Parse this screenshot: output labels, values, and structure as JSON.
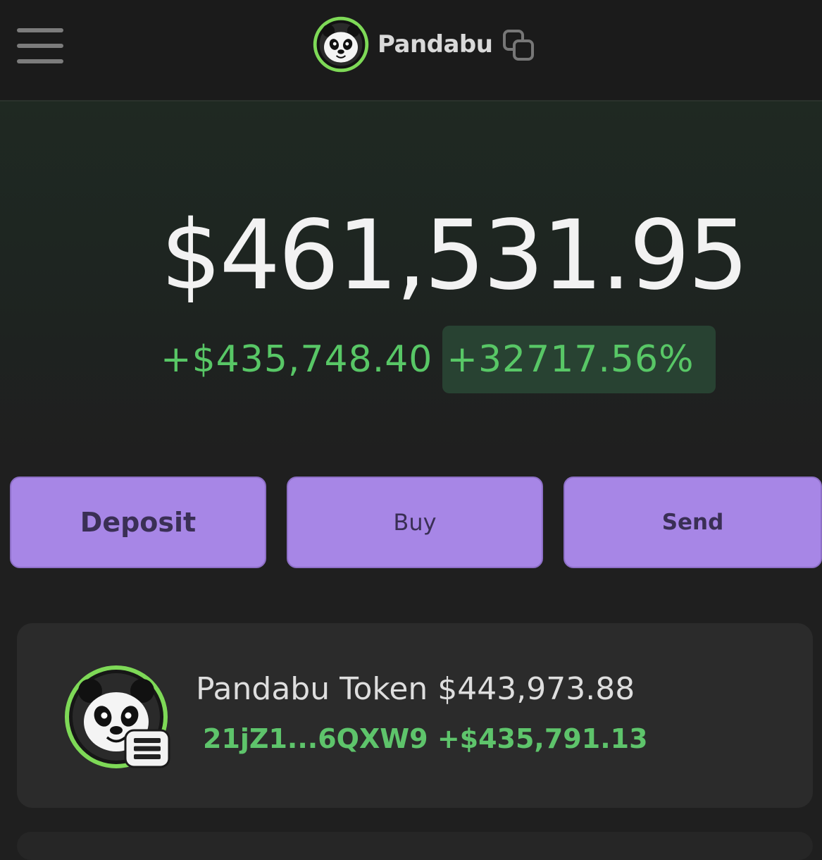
{
  "app": {
    "name": "Pandabu"
  },
  "balance": {
    "total": "$461,531.95",
    "change_amount": "+$435,748.40",
    "change_percent": "+32717.56%"
  },
  "actions": {
    "deposit": "Deposit",
    "buy": "Buy",
    "send": "Send"
  },
  "tokens": [
    {
      "name_value": "Pandabu Token $443,973.88",
      "address_change": "21jZ1...6QXW9 +$435,791.13"
    }
  ],
  "colors": {
    "background": "#1f1f1f",
    "accent_purple": "#a786e6",
    "positive_green": "#58c766",
    "logo_ring": "#7ed957"
  },
  "icons": {
    "menu": "hamburger-menu-icon",
    "logo": "panda-logo-icon",
    "copy": "copy-icon",
    "chain": "solana-chain-icon"
  }
}
